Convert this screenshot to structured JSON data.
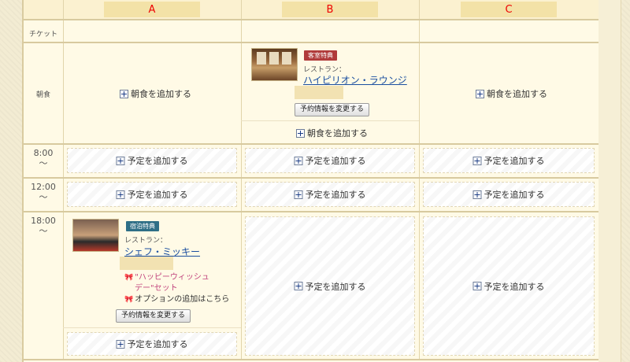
{
  "columns": [
    "A",
    "B",
    "C"
  ],
  "rows": {
    "ticket": "チケット",
    "breakfast": "朝食"
  },
  "times": {
    "t8": "8:00",
    "t12": "12:00",
    "t18": "18:00",
    "tilde": "〜"
  },
  "actions": {
    "add_breakfast": "朝食を追加する",
    "add_plan": "予定を追加する",
    "change_reservation": "予約情報を変更する"
  },
  "breakfast_b": {
    "badge": "客室特典",
    "restaurant_label": "レストラン：",
    "restaurant_name": "ハイピリオン・ラウンジ"
  },
  "dinner_a": {
    "badge": "宿泊特典",
    "restaurant_label": "レストラン：",
    "restaurant_name": "シェフ・ミッキー",
    "set_line1": "\"ハッピーウィッシュ",
    "set_line2": "デー\"セット",
    "option_link": "オプションの追加はこちら"
  },
  "icons": {
    "plus": "plus-icon",
    "ribbon": "ribbon-icon"
  },
  "colors": {
    "column_header_text": "#ee0000",
    "link": "#1b4fa0",
    "badge_red": "#b03a3a",
    "badge_teal": "#2f6f86",
    "pink_text": "#c2457d"
  }
}
